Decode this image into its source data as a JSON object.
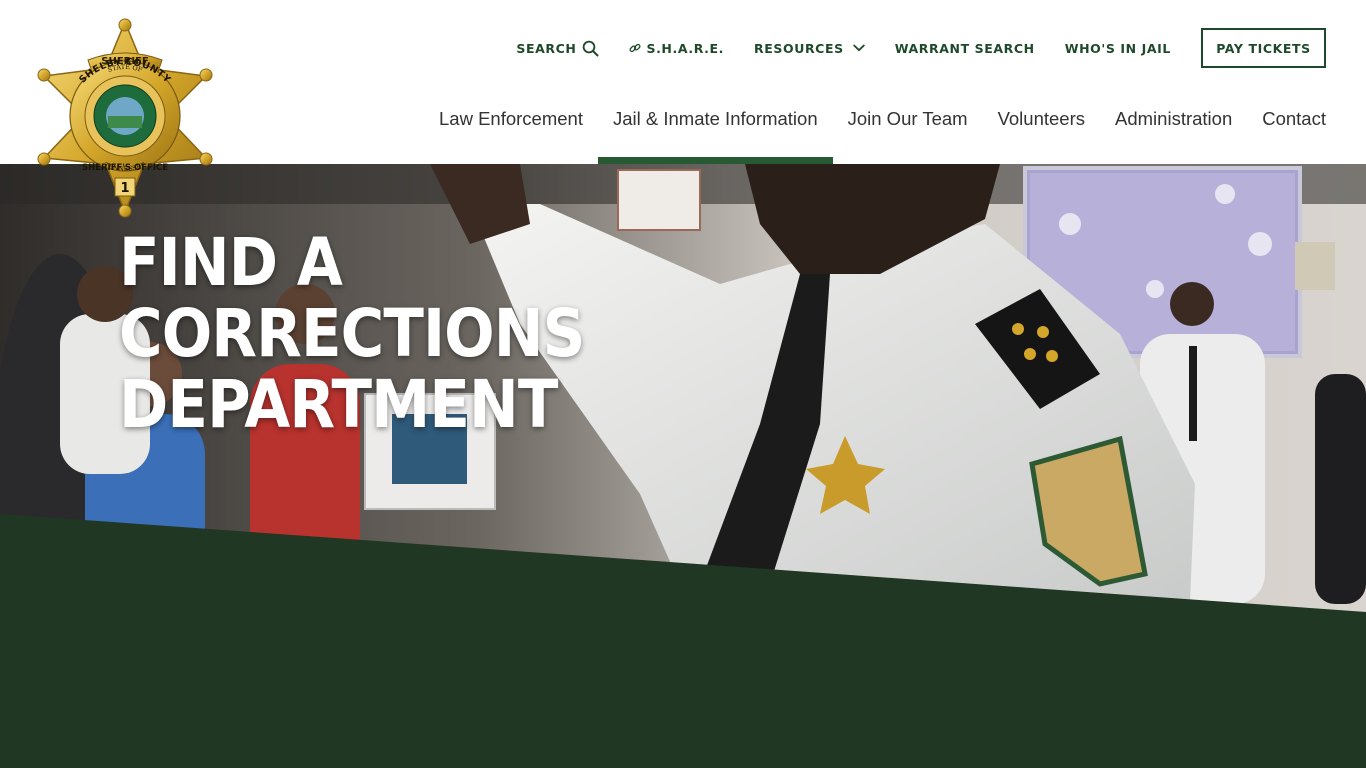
{
  "logo": {
    "top_text": "SHERIFF",
    "ring_text": "SHELBY COUNTY",
    "state_text": "STATE OF",
    "state_name": "TENNESSEE",
    "bottom_text": "SHERIFF'S OFFICE",
    "number": "1"
  },
  "utility_nav": {
    "search": "SEARCH",
    "share": "S.H.A.R.E.",
    "resources": "RESOURCES",
    "warrant_search": "WARRANT SEARCH",
    "whos_in_jail": "WHO'S IN JAIL",
    "pay_tickets": "PAY TICKETS"
  },
  "main_nav": {
    "items": [
      {
        "label": "Law Enforcement",
        "active": false
      },
      {
        "label": "Jail & Inmate Information",
        "active": true
      },
      {
        "label": "Join Our Team",
        "active": false
      },
      {
        "label": "Volunteers",
        "active": false
      },
      {
        "label": "Administration",
        "active": false
      },
      {
        "label": "Contact",
        "active": false
      }
    ]
  },
  "hero": {
    "title_lines": [
      "FIND A",
      "CORRECTIONS",
      "DEPARTMENT"
    ]
  },
  "colors": {
    "brand_green": "#1f4a2a",
    "active_underline": "#275a33",
    "band_green": "#203724",
    "badge_gold": "#d4a62a"
  },
  "icons": {
    "search": "search-icon",
    "share": "link-icon",
    "resources": "chevron-down-icon"
  }
}
